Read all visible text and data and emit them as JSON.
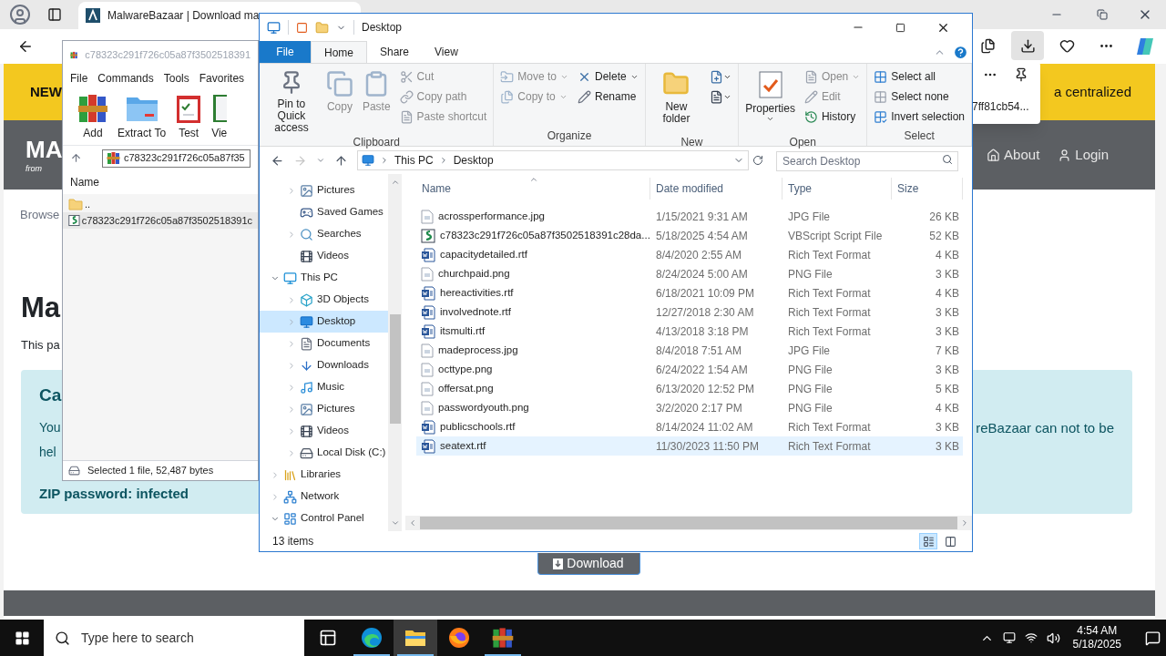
{
  "browser": {
    "tab_title": "MalwareBazaar | Download ma",
    "banner_lead": "NEW",
    "banner_tail": "a centralized",
    "flyout_item": "7ff81cb54...",
    "logo": "MA",
    "logo_sub": "from",
    "nav": [
      "About",
      "Login"
    ],
    "breadcrumb": "Browse",
    "heading": "Ma",
    "intro": "This pa",
    "card": {
      "title": "Ca",
      "line_1": "You",
      "line_1_tail": "reBazaar can not to be",
      "line_2": "hel",
      "password": "ZIP password: infected"
    },
    "download_button": "Download"
  },
  "winrar": {
    "title": "c78323c291f726c05a87f3502518391",
    "menu": [
      "File",
      "Commands",
      "Tools",
      "Favorites"
    ],
    "toolbar": [
      {
        "label": "Add",
        "kind": "add"
      },
      {
        "label": "Extract To",
        "kind": "extract"
      },
      {
        "label": "Test",
        "kind": "test"
      },
      {
        "label": "Vie",
        "kind": "view"
      }
    ],
    "path": "c78323c291f726c05a87f35",
    "column": "Name",
    "rows": [
      {
        "name": "..",
        "kind": "folder",
        "selected": false
      },
      {
        "name": "c78323c291f726c05a87f3502518391c",
        "kind": "script",
        "selected": true
      }
    ],
    "status": "Selected 1 file, 52,487 bytes"
  },
  "explorer": {
    "title": "Desktop",
    "ribbon_tabs": [
      {
        "label": "File",
        "kind": "file",
        "selected": false
      },
      {
        "label": "Home",
        "kind": "tab",
        "selected": true
      },
      {
        "label": "Share",
        "kind": "tab",
        "selected": false
      },
      {
        "label": "View",
        "kind": "tab",
        "selected": false
      }
    ],
    "ribbon_groups": [
      {
        "label": "Clipboard",
        "columns": [
          [
            {
              "kind": "large",
              "label": "Pin to Quick access",
              "disabled": false,
              "dropdown": false
            }
          ],
          [
            {
              "kind": "large",
              "label": "Copy",
              "disabled": true,
              "dropdown": false
            }
          ],
          [
            {
              "kind": "large",
              "label": "Paste",
              "disabled": true,
              "dropdown": false
            }
          ],
          [
            {
              "kind": "small",
              "label": "Cut",
              "disabled": true,
              "dropdown": false
            },
            {
              "kind": "small",
              "label": "Copy path",
              "disabled": true,
              "dropdown": false
            },
            {
              "kind": "small",
              "label": "Paste shortcut",
              "disabled": true,
              "dropdown": false
            }
          ]
        ]
      },
      {
        "label": "Organize",
        "columns": [
          [
            {
              "kind": "small",
              "label": "Move to",
              "disabled": true,
              "dropdown": true
            },
            {
              "kind": "small",
              "label": "Copy to",
              "disabled": true,
              "dropdown": true
            }
          ],
          [
            {
              "kind": "small",
              "label": "Delete",
              "disabled": false,
              "dropdown": true
            },
            {
              "kind": "small",
              "label": "Rename",
              "disabled": false,
              "dropdown": false
            }
          ]
        ]
      },
      {
        "label": "New",
        "columns": [
          [
            {
              "kind": "large",
              "label": "New folder",
              "disabled": false,
              "dropdown": false
            }
          ],
          [
            {
              "kind": "icon",
              "disabled": false,
              "dropdown": true
            },
            {
              "kind": "icon",
              "disabled": false,
              "dropdown": true
            }
          ]
        ]
      },
      {
        "label": "Open",
        "columns": [
          [
            {
              "kind": "large",
              "label": "Properties",
              "disabled": false,
              "dropdown": true
            }
          ],
          [
            {
              "kind": "small",
              "label": "Open",
              "disabled": true,
              "dropdown": true
            },
            {
              "kind": "small",
              "label": "Edit",
              "disabled": true,
              "dropdown": false
            },
            {
              "kind": "small",
              "label": "History",
              "disabled": false,
              "dropdown": false
            }
          ]
        ]
      },
      {
        "label": "Select",
        "columns": [
          [
            {
              "kind": "small",
              "label": "Select all",
              "disabled": false,
              "dropdown": false
            },
            {
              "kind": "small",
              "label": "Select none",
              "disabled": false,
              "dropdown": false
            },
            {
              "kind": "small",
              "label": "Invert selection",
              "disabled": false,
              "dropdown": false
            }
          ]
        ]
      }
    ],
    "address": [
      "This PC",
      "Desktop"
    ],
    "search": {
      "placeholder": "Search Desktop"
    },
    "tree": [
      {
        "children": [
          {
            "label": "Pictures",
            "kind": "pictures",
            "expanded": false,
            "selected": false
          },
          {
            "label": "Saved Games",
            "kind": "games",
            "selected": false
          },
          {
            "label": "Searches",
            "kind": "search",
            "expanded": false,
            "selected": false
          },
          {
            "label": "Videos",
            "kind": "videos",
            "selected": false
          }
        ]
      },
      {
        "label": "This PC",
        "kind": "pc",
        "expanded": true,
        "selected": false,
        "children": [
          {
            "label": "3D Objects",
            "kind": "objects",
            "expanded": false,
            "selected": false
          },
          {
            "label": "Desktop",
            "kind": "desktop",
            "expanded": false,
            "selected": true
          },
          {
            "label": "Documents",
            "kind": "documents",
            "expanded": false,
            "selected": false
          },
          {
            "label": "Downloads",
            "kind": "downloads",
            "expanded": false,
            "selected": false
          },
          {
            "label": "Music",
            "kind": "music",
            "expanded": false,
            "selected": false
          },
          {
            "label": "Pictures",
            "kind": "pictures",
            "expanded": false,
            "selected": false
          },
          {
            "label": "Videos",
            "kind": "videos",
            "expanded": false,
            "selected": false
          },
          {
            "label": "Local Disk (C:)",
            "kind": "disk",
            "expanded": false,
            "selected": false
          }
        ]
      },
      {
        "label": "Libraries",
        "kind": "libraries",
        "expanded": false,
        "selected": false
      },
      {
        "label": "Network",
        "kind": "network",
        "expanded": false,
        "selected": false
      },
      {
        "label": "Control Panel",
        "kind": "control",
        "expanded": true,
        "selected": false
      }
    ],
    "columns": [
      "Name",
      "Date modified",
      "Type",
      "Size"
    ],
    "files": [
      {
        "name": "acrossperformance.jpg",
        "date": "1/15/2021 9:31 AM",
        "type": "JPG File",
        "size": "26 KB",
        "kind": "image",
        "selected": false
      },
      {
        "name": "c78323c291f726c05a87f3502518391c28da...",
        "date": "5/18/2025 4:54 AM",
        "type": "VBScript Script File",
        "size": "52 KB",
        "kind": "script",
        "selected": false
      },
      {
        "name": "capacitydetailed.rtf",
        "date": "8/4/2020 2:55 AM",
        "type": "Rich Text Format",
        "size": "4 KB",
        "kind": "rtf",
        "selected": false
      },
      {
        "name": "churchpaid.png",
        "date": "8/24/2024 5:00 AM",
        "type": "PNG File",
        "size": "3 KB",
        "kind": "image",
        "selected": false
      },
      {
        "name": "hereactivities.rtf",
        "date": "6/18/2021 10:09 PM",
        "type": "Rich Text Format",
        "size": "4 KB",
        "kind": "rtf",
        "selected": false
      },
      {
        "name": "involvednote.rtf",
        "date": "12/27/2018 2:30 AM",
        "type": "Rich Text Format",
        "size": "3 KB",
        "kind": "rtf",
        "selected": false
      },
      {
        "name": "itsmulti.rtf",
        "date": "4/13/2018 3:18 PM",
        "type": "Rich Text Format",
        "size": "3 KB",
        "kind": "rtf",
        "selected": false
      },
      {
        "name": "madeprocess.jpg",
        "date": "8/4/2018 7:51 AM",
        "type": "JPG File",
        "size": "7 KB",
        "kind": "image",
        "selected": false
      },
      {
        "name": "octtype.png",
        "date": "6/24/2022 1:54 AM",
        "type": "PNG File",
        "size": "3 KB",
        "kind": "image",
        "selected": false
      },
      {
        "name": "offersat.png",
        "date": "6/13/2020 12:52 PM",
        "type": "PNG File",
        "size": "5 KB",
        "kind": "image",
        "selected": false
      },
      {
        "name": "passwordyouth.png",
        "date": "3/2/2020 2:17 PM",
        "type": "PNG File",
        "size": "4 KB",
        "kind": "image",
        "selected": false
      },
      {
        "name": "publicschools.rtf",
        "date": "8/14/2024 11:02 AM",
        "type": "Rich Text Format",
        "size": "3 KB",
        "kind": "rtf",
        "selected": false
      },
      {
        "name": "seatext.rtf",
        "date": "11/30/2023 11:50 PM",
        "type": "Rich Text Format",
        "size": "3 KB",
        "kind": "rtf",
        "selected": true
      }
    ],
    "status": "13 items",
    "views": [
      {
        "kind": "details",
        "selected": true
      },
      {
        "kind": "tiles",
        "selected": false
      }
    ]
  },
  "taskbar": {
    "search_placeholder": "Type here to search",
    "apps": [
      {
        "kind": "taskview",
        "running": false,
        "selected": false
      },
      {
        "kind": "edge",
        "running": true,
        "selected": false
      },
      {
        "kind": "explorer",
        "running": true,
        "selected": true
      },
      {
        "kind": "firefox",
        "running": false,
        "selected": false
      },
      {
        "kind": "winrar",
        "running": true,
        "selected": false
      }
    ],
    "time": "4:54 AM",
    "date": "5/18/2025"
  }
}
